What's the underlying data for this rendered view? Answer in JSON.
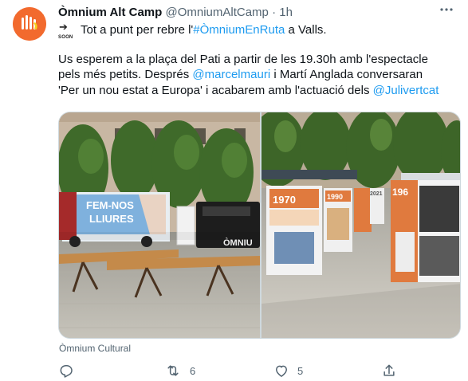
{
  "author": {
    "name": "Òmnium Alt Camp",
    "handle": "@OmniumAltCamp",
    "separator": "·",
    "time": "1h"
  },
  "tweet": {
    "soon_icon_label": "SOON",
    "line1_pre": "Tot a punt per rebre l'",
    "line1_hashtag": "#ÒmniumEnRuta",
    "line1_post": " a Valls.",
    "line2": "Us esperem a la plaça del Pati a partir de les 19.30h amb l'espectacle",
    "line3_pre": "pels més petits. Després ",
    "line3_mention": "@marcelmauri",
    "line3_post": " i Martí Anglada conversaran",
    "line4_pre": "'Per un nou estat a Europa' i acabarem amb l'actuació dels ",
    "line4_mention": "@Julivertcat"
  },
  "media": {
    "left_photo": {
      "banner_line1": "FEM-NOS",
      "banner_line2": "LLIURES",
      "truck_text": "ÒMNIU"
    },
    "right_photo": {
      "panel1_year": "1970",
      "panel2_year": "1990",
      "panel3_year": "2021",
      "panel4_year": "196"
    }
  },
  "caption": "Òmnium Cultural",
  "actions": {
    "reply_count": "",
    "retweet_count": "6",
    "like_count": "5"
  },
  "colors": {
    "link": "#1d9bf0",
    "secondary_text": "#536471",
    "avatar_bg": "#f26a2e"
  }
}
